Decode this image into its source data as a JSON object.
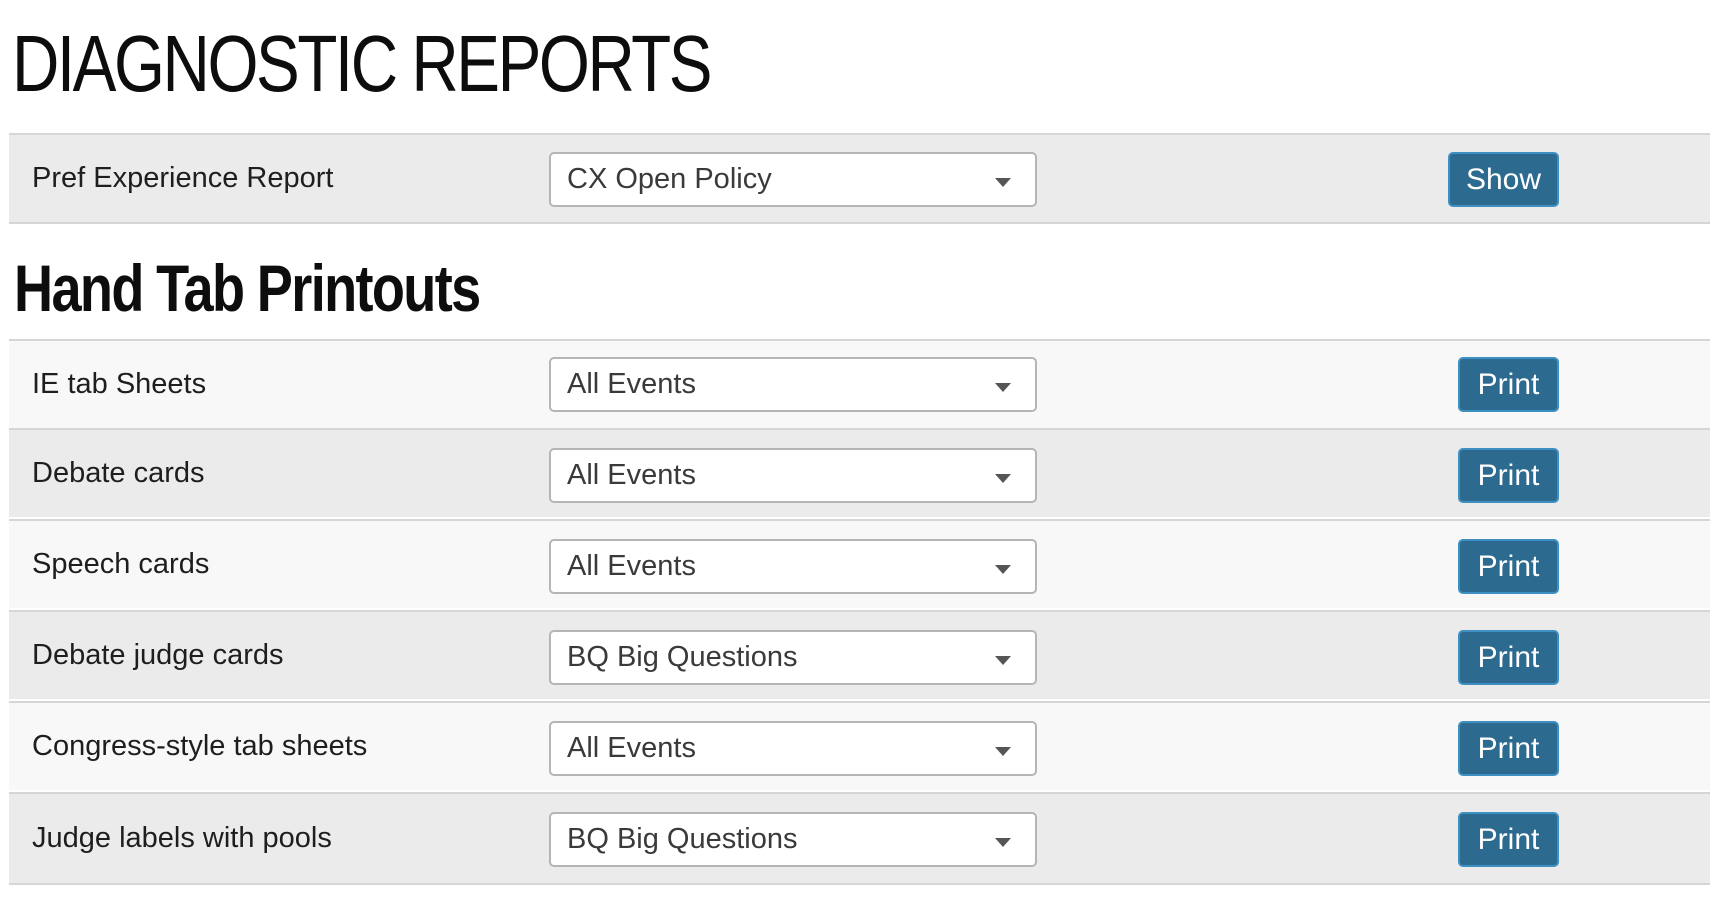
{
  "page": {
    "title": "DIAGNOSTIC REPORTS"
  },
  "diagnostic": {
    "label": "Pref Experience Report",
    "selected": "CX Open Policy",
    "button_label": "Show"
  },
  "hand_tab": {
    "heading": "Hand Tab Printouts",
    "rows": [
      {
        "label": "IE tab Sheets",
        "selected": "All Events",
        "button_label": "Print"
      },
      {
        "label": "Debate cards",
        "selected": "All Events",
        "button_label": "Print"
      },
      {
        "label": "Speech cards",
        "selected": "All Events",
        "button_label": "Print"
      },
      {
        "label": "Debate judge cards",
        "selected": "BQ Big Questions",
        "button_label": "Print"
      },
      {
        "label": "Congress-style tab sheets",
        "selected": "All Events",
        "button_label": "Print"
      },
      {
        "label": "Judge labels with pools",
        "selected": "BQ Big Questions",
        "button_label": "Print"
      }
    ]
  },
  "icons": {
    "select_caret": "chevron-down-icon"
  },
  "colors": {
    "button_bg": "#2d6a90",
    "button_border": "#3f90c2",
    "row_shade": "#ebebeb",
    "row_light": "#f8f8f8"
  }
}
